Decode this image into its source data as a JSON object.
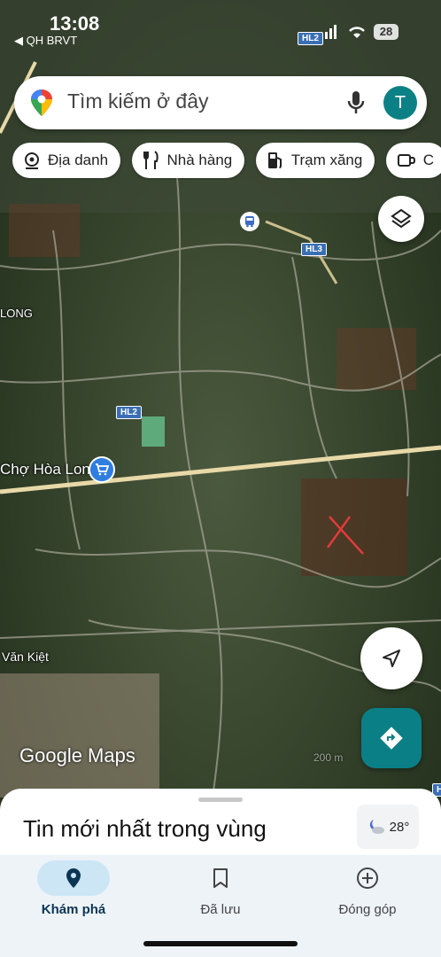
{
  "status": {
    "time": "13:08",
    "back_label": "◀ QH BRVT",
    "battery": "28"
  },
  "search": {
    "placeholder": "Tìm kiếm ở đây",
    "avatar_letter": "T"
  },
  "chips": [
    {
      "label": "Địa danh",
      "icon": "landmark-icon"
    },
    {
      "label": "Nhà hàng",
      "icon": "restaurant-icon"
    },
    {
      "label": "Trạm xăng",
      "icon": "gas-station-icon"
    },
    {
      "label": "C",
      "icon": "coffee-icon"
    }
  ],
  "map": {
    "labels": {
      "market": "Chợ Hòa Long",
      "long": "LONG",
      "street": "Văn Kiệt"
    },
    "shields": {
      "hl2_top": "HL2",
      "hl3": "HL3",
      "hl2": "HL2",
      "h_edge": "H"
    },
    "scale": "200 m",
    "watermark": "Google Maps",
    "colors": {
      "road_main": "#e8d9a8",
      "marker": "#e23b3b"
    }
  },
  "sheet": {
    "title": "Tin mới nhất trong vùng",
    "weather": "28°"
  },
  "nav": {
    "explore": "Khám phá",
    "saved": "Đã lưu",
    "contribute": "Đóng góp"
  }
}
